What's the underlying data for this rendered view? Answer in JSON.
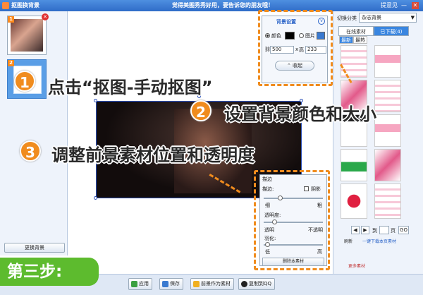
{
  "window": {
    "title": "抠图换背景",
    "slogan": "觉得美图秀秀好用，要告诉您的朋友哦！",
    "help": "提意见",
    "minimize": "—",
    "close": "✕"
  },
  "left_panel": {
    "thumbs": [
      {
        "number": "1"
      },
      {
        "number": "2"
      }
    ],
    "change_bg_label": "更换背景"
  },
  "right_panel": {
    "category_label": "切换分类",
    "category_value": "杂志背景",
    "tabs": [
      "在线素材",
      "已下载(4)"
    ],
    "subtabs": [
      "最新",
      "最热"
    ],
    "pager": {
      "to_label": "到",
      "page_label": "页",
      "go": "GO",
      "prev": "◀",
      "next": "▶"
    },
    "refresh": "刷新",
    "download_all": "一键下载本页素材",
    "more": "更多素材"
  },
  "bg_panel": {
    "title": "背景设置",
    "color_label": "颜色",
    "image_label": "图片",
    "width": "500",
    "times": "x",
    "height_label": "高",
    "height": "233",
    "collapse_label": "收起"
  },
  "fg_panel": {
    "title": "描边",
    "stroke_label": "描边:",
    "shadow_label": "阴影",
    "thin": "细",
    "thick": "粗",
    "opacity_label": "透明度:",
    "transparent": "透明",
    "opaque": "不透明",
    "feather_label": "羽化:",
    "low": "低",
    "high": "高",
    "delete_label": "删除本素材"
  },
  "toolbar": {
    "apply": "应用",
    "save": "保存",
    "set_as_fg": "前景作为素材",
    "copy_qq": "复制到QQ"
  },
  "annotations": {
    "step_label": "第三步:",
    "b1": "1",
    "t1": "点击“抠图-手动抠图”",
    "b2": "2",
    "t2": "设置背景颜色和大小",
    "b3": "3",
    "t3": "调整前景素材位置和透明度"
  },
  "colors": {
    "accent": "#f08c1e",
    "titlebar": "#3a7ad6",
    "step_green": "#5dbb2e",
    "active_tab": "#3a86e0"
  }
}
